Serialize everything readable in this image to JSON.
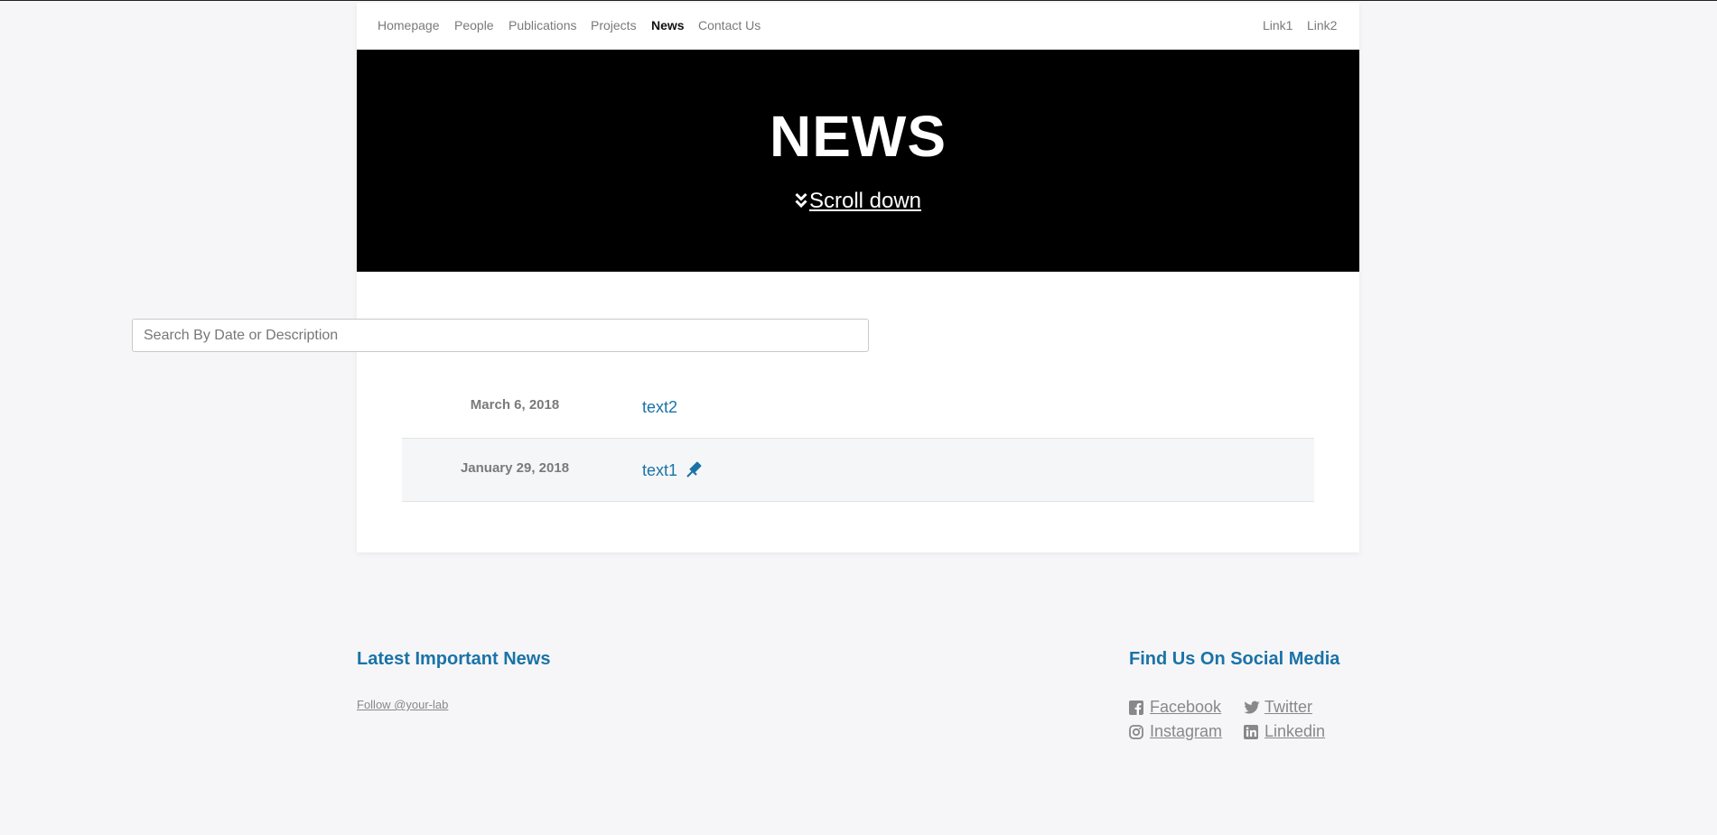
{
  "nav": {
    "left": [
      "Homepage",
      "People",
      "Publications",
      "Projects",
      "News",
      "Contact Us"
    ],
    "right": [
      "Link1",
      "Link2"
    ],
    "active": "News"
  },
  "hero": {
    "title": "NEWS",
    "scroll_label": "Scroll down",
    "scroll_icon": "double-chevron-down-icon"
  },
  "search": {
    "placeholder": "Search By Date or Description",
    "value": ""
  },
  "news": [
    {
      "date": "March 6, 2018",
      "text": "text2",
      "pinned": false
    },
    {
      "date": "January 29, 2018",
      "text": "text1",
      "pinned": true,
      "pin_icon": "pushpin-icon"
    }
  ],
  "footer": {
    "latest_heading": "Latest Important News",
    "follow_label": "Follow @your-lab",
    "social_heading": "Find Us On Social Media",
    "social": [
      {
        "label": "Facebook",
        "icon": "facebook-icon"
      },
      {
        "label": "Twitter",
        "icon": "twitter-icon"
      },
      {
        "label": "Instagram",
        "icon": "instagram-icon"
      },
      {
        "label": "Linkedin",
        "icon": "linkedin-icon"
      }
    ]
  },
  "colors": {
    "accent": "#1a73a7",
    "background": "#f6f6f8",
    "hero": "#000000",
    "muted": "#7a7a7a"
  }
}
